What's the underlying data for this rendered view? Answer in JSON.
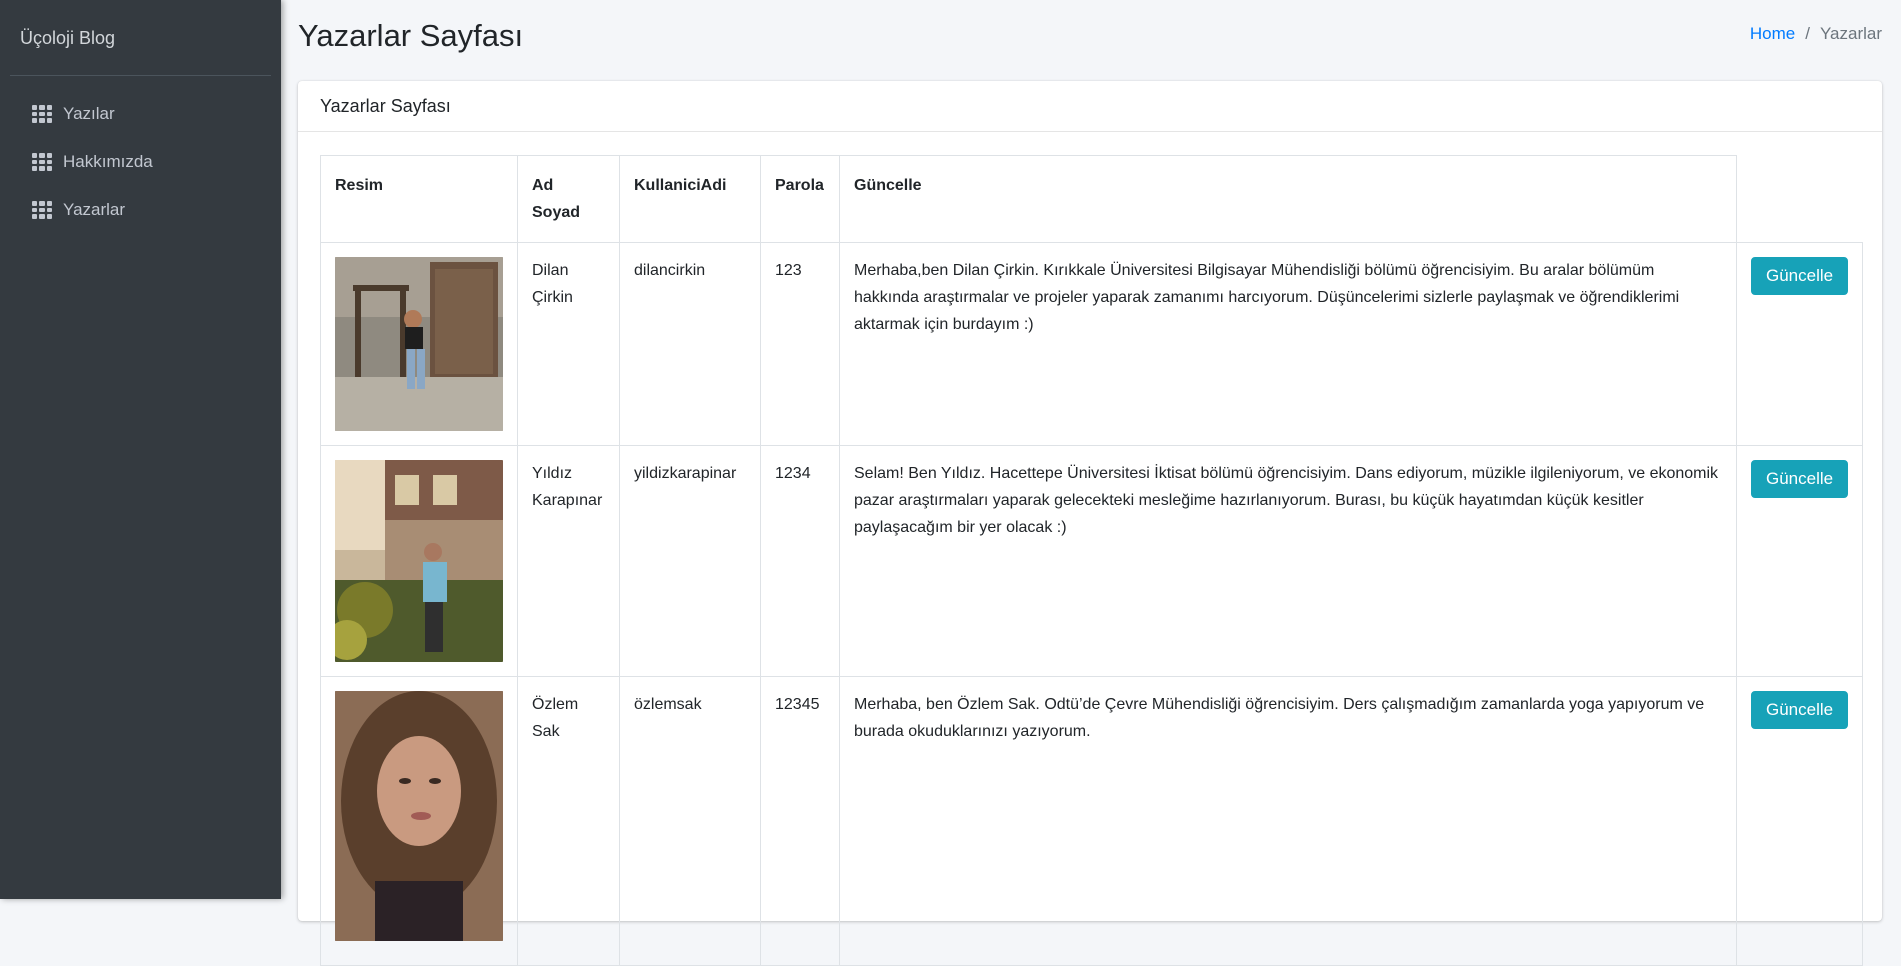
{
  "sidebar": {
    "brand": "Üçoloji Blog",
    "items": [
      {
        "label": "Yazılar",
        "icon": "grid-icon"
      },
      {
        "label": "Hakkımızda",
        "icon": "grid-icon"
      },
      {
        "label": "Yazarlar",
        "icon": "grid-icon"
      }
    ]
  },
  "header": {
    "title": "Yazarlar Sayfası",
    "breadcrumb": {
      "home": "Home",
      "separator": "/",
      "current": "Yazarlar"
    }
  },
  "card": {
    "title": "Yazarlar Sayfası"
  },
  "table": {
    "columns": [
      "Resim",
      "Ad Soyad",
      "KullaniciAdi",
      "Parola",
      "Güncelle"
    ],
    "button_label": "Güncelle",
    "rows": [
      {
        "name": "Dilan Çirkin",
        "username": "dilancirkin",
        "password": "123",
        "bio": "Merhaba,ben Dilan Çirkin. Kırıkkale Üniversitesi Bilgisayar Mühendisliği bölümü öğrencisiyim. Bu aralar bölümüm hakkında araştırmalar ve projeler yaparak zamanımı harcıyorum. Düşüncelerimi sizlerle paylaşmak ve öğrendiklerimi aktarmak için burdayım :)"
      },
      {
        "name": "Yıldız Karapınar",
        "username": "yildizkarapinar",
        "password": "1234",
        "bio": "Selam! Ben Yıldız. Hacettepe Üniversitesi İktisat bölümü öğrencisiyim. Dans ediyorum, müzikle ilgileniyorum, ve ekonomik pazar araştırmaları yaparak gelecekteki mesleğime hazırlanıyorum. Burası, bu küçük hayatımdan küçük kesitler paylaşacağım bir yer olacak :)"
      },
      {
        "name": "Özlem Sak",
        "username": "özlemsak",
        "password": "12345",
        "bio": "Merhaba, ben Özlem Sak. Odtü’de Çevre Mühendisliği öğrencisiyim. Ders çalışmadığım zamanlarda yoga yapıyorum ve burada okuduklarınızı yazıyorum."
      }
    ]
  },
  "colors": {
    "sidebar_bg": "#343a40",
    "accent_button": "#17a2b8",
    "link": "#007bff"
  }
}
